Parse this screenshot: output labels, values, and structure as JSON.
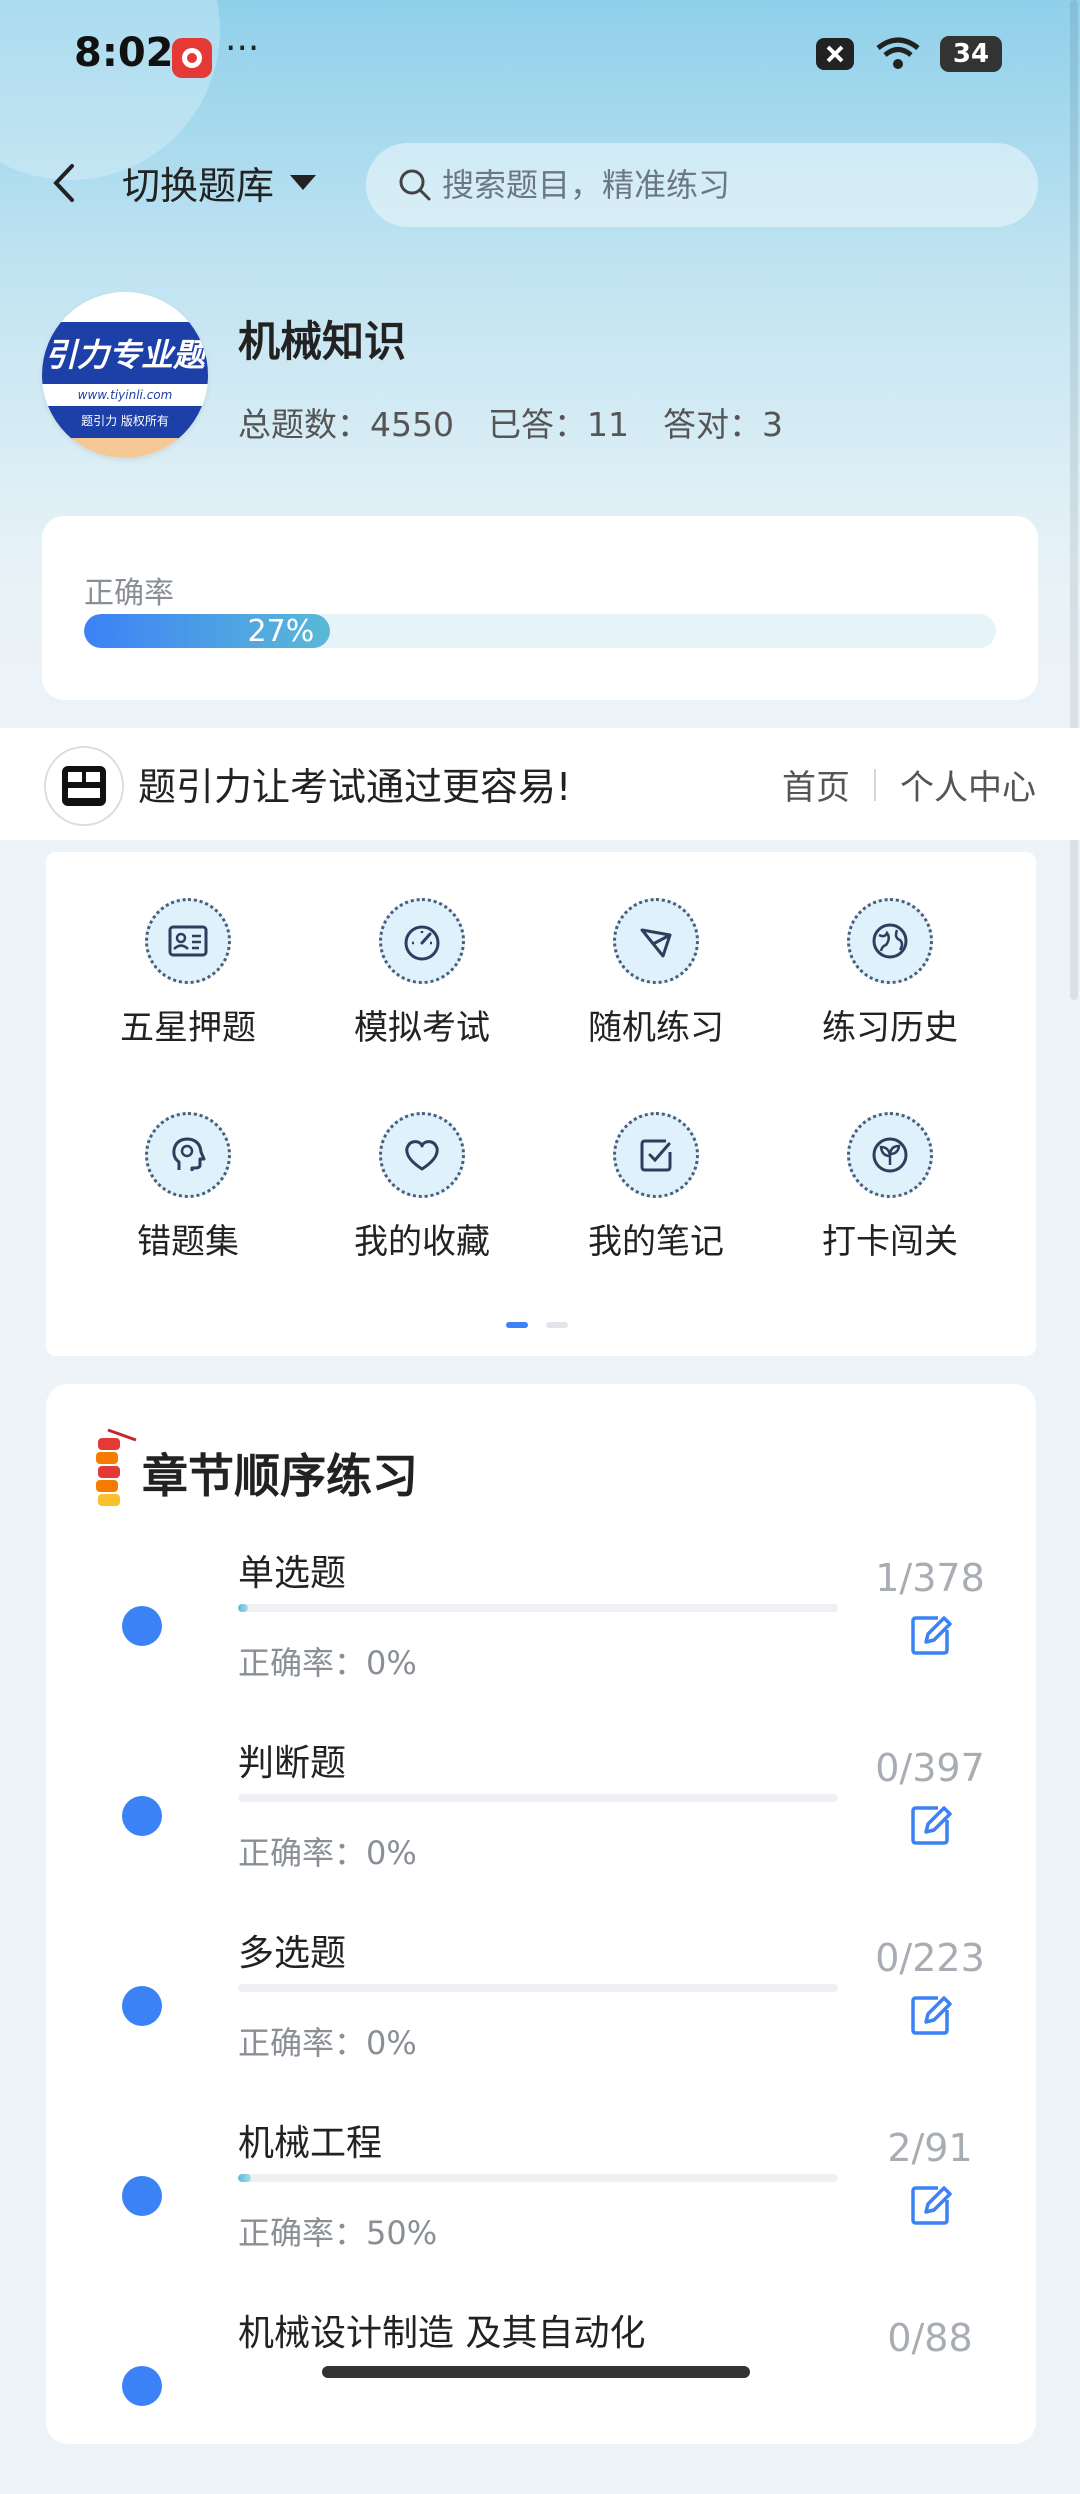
{
  "status_bar": {
    "time": "8:02",
    "more": "···",
    "battery": "34"
  },
  "header": {
    "switch_bank_label": "切换题库",
    "search_placeholder": "搜索题目，精准练习"
  },
  "bank": {
    "logo_text": "引力专业题",
    "logo_url_text": "www.tiyinli.com",
    "logo_copyright": "题引力 版权所有",
    "title": "机械知识",
    "stats": {
      "total": "总题数：4550",
      "answered": "已答：11",
      "correct": "答对：3"
    }
  },
  "accuracy": {
    "label": "正确率",
    "value": "27%",
    "fraction": 0.27
  },
  "banner": {
    "text": "题引力让考试通过更容易!",
    "links": [
      "首页",
      "个人中心"
    ]
  },
  "tools": [
    {
      "label": "五星押题",
      "icon": "id-card-icon"
    },
    {
      "label": "模拟考试",
      "icon": "speedometer-icon"
    },
    {
      "label": "随机练习",
      "icon": "shuffle-icon"
    },
    {
      "label": "练习历史",
      "icon": "globe-icon"
    },
    {
      "label": "错题集",
      "icon": "head-icon"
    },
    {
      "label": "我的收藏",
      "icon": "heart-icon"
    },
    {
      "label": "我的笔记",
      "icon": "note-check-icon"
    },
    {
      "label": "打卡闯关",
      "icon": "sprout-icon"
    }
  ],
  "chapter": {
    "title": "章节顺序练习",
    "rows": [
      {
        "name": "单选题",
        "accuracy": "正确率：0%",
        "count": "1/378",
        "progress": 0.003
      },
      {
        "name": "判断题",
        "accuracy": "正确率：0%",
        "count": "0/397",
        "progress": 0
      },
      {
        "name": "多选题",
        "accuracy": "正确率：0%",
        "count": "0/223",
        "progress": 0
      },
      {
        "name": "机械工程",
        "accuracy": "正确率：50%",
        "count": "2/91",
        "progress": 0.022
      },
      {
        "name": "机械设计制造 及其自动化",
        "accuracy": "",
        "count": "0/88",
        "progress": 0
      }
    ]
  },
  "colors": {
    "accent": "#3b82f6",
    "teal": "#5bb9d6"
  }
}
